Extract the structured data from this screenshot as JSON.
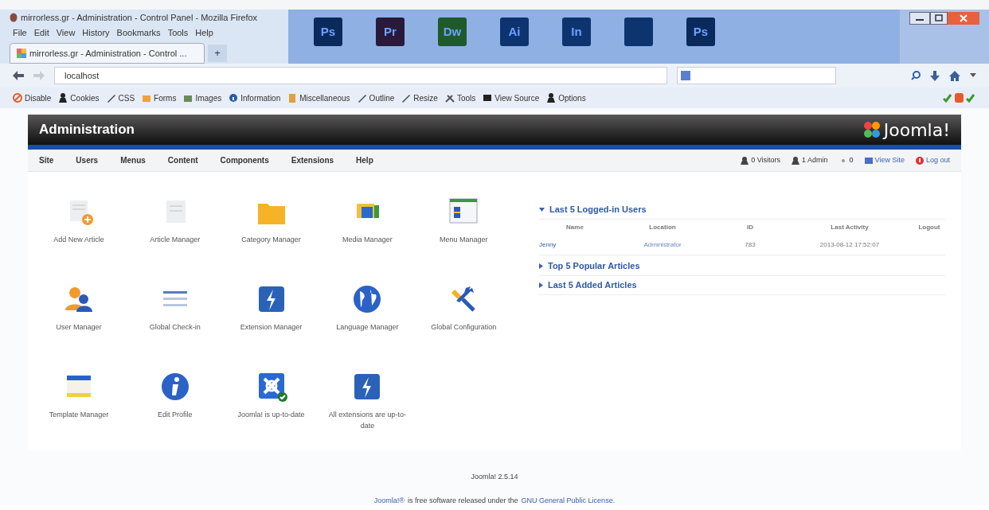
{
  "browser": {
    "title": "mirrorless.gr - Administration - Control Panel - Mozilla Firefox",
    "menu": [
      "File",
      "Edit",
      "View",
      "History",
      "Bookmarks",
      "Tools",
      "Help"
    ],
    "tab": {
      "title": "mirrorless.gr - Administration - Control ...",
      "new_tab": "+"
    },
    "url": "localhost",
    "toolbar": [
      {
        "label": "Disable",
        "kind": "ban"
      },
      {
        "label": "Cookies",
        "kind": "person"
      },
      {
        "label": "CSS",
        "kind": "pen"
      },
      {
        "label": "Forms",
        "kind": "form"
      },
      {
        "label": "Images",
        "kind": "image"
      },
      {
        "label": "Information",
        "kind": "info"
      },
      {
        "label": "Miscellaneous",
        "kind": "misc"
      },
      {
        "label": "Outline",
        "kind": "pen"
      },
      {
        "label": "Resize",
        "kind": "pen"
      },
      {
        "label": "Tools",
        "kind": "tools"
      },
      {
        "label": "View Source",
        "kind": "source"
      },
      {
        "label": "Options",
        "kind": "person"
      }
    ]
  },
  "desktop_icons": [
    {
      "text": "Ps",
      "color": "#0b2a5c"
    },
    {
      "text": "Pr",
      "color": "#2a1a3a"
    },
    {
      "text": "Dw",
      "color": "#1f5a2a"
    },
    {
      "text": "Ai",
      "color": "#0e3470"
    },
    {
      "text": "In",
      "color": "#0e3470"
    },
    {
      "color": "#0e3470"
    },
    {
      "text": "Ps",
      "color": "#0b2a5c"
    }
  ],
  "header": {
    "title": "Administration",
    "logo": "Joomla!"
  },
  "nav": [
    "Site",
    "Users",
    "Menus",
    "Content",
    "Components",
    "Extensions",
    "Help"
  ],
  "status": [
    {
      "label": "0 Visitors",
      "kind": "person"
    },
    {
      "label": "1 Admin",
      "kind": "person"
    },
    {
      "label": "0",
      "kind": "mail"
    },
    {
      "label": "View Site",
      "kind": "site"
    },
    {
      "label": "Log out",
      "kind": "logout"
    }
  ],
  "quickicons": [
    {
      "label": "Add New Article",
      "kind": "add"
    },
    {
      "label": "Article Manager",
      "kind": "doc"
    },
    {
      "label": "Category Manager",
      "kind": "folder"
    },
    {
      "label": "Media Manager",
      "kind": "media"
    },
    {
      "label": "Menu Manager",
      "kind": "menu"
    },
    {
      "label": "User Manager",
      "kind": "users"
    },
    {
      "label": "Global Check-in",
      "kind": "checkin"
    },
    {
      "label": "Extension Manager",
      "kind": "bolt"
    },
    {
      "label": "Language Manager",
      "kind": "globe"
    },
    {
      "label": "Global Configuration",
      "kind": "wrench"
    },
    {
      "label": "Template Manager",
      "kind": "template"
    },
    {
      "label": "Edit Profile",
      "kind": "info"
    },
    {
      "label": "Joomla! is up-to-date",
      "kind": "joomla"
    },
    {
      "label": "All extensions are up-to-date",
      "kind": "bolt"
    }
  ],
  "panels": [
    {
      "title": "Last 5 Logged-in Users",
      "expanded": true,
      "columns": [
        "Name",
        "Location",
        "ID",
        "Last Activity",
        "Logout"
      ],
      "rows": [
        [
          "Jenny",
          "Administrator",
          "783",
          "2013-08-12 17:52:07",
          ""
        ]
      ]
    },
    {
      "title": "Top 5 Popular Articles",
      "expanded": false
    },
    {
      "title": "Last 5 Added Articles",
      "expanded": false
    }
  ],
  "footer": {
    "version": "Joomla! 2.5.14",
    "license": [
      "Joomla!®",
      "is free software released under the",
      "GNU General Public License."
    ]
  }
}
